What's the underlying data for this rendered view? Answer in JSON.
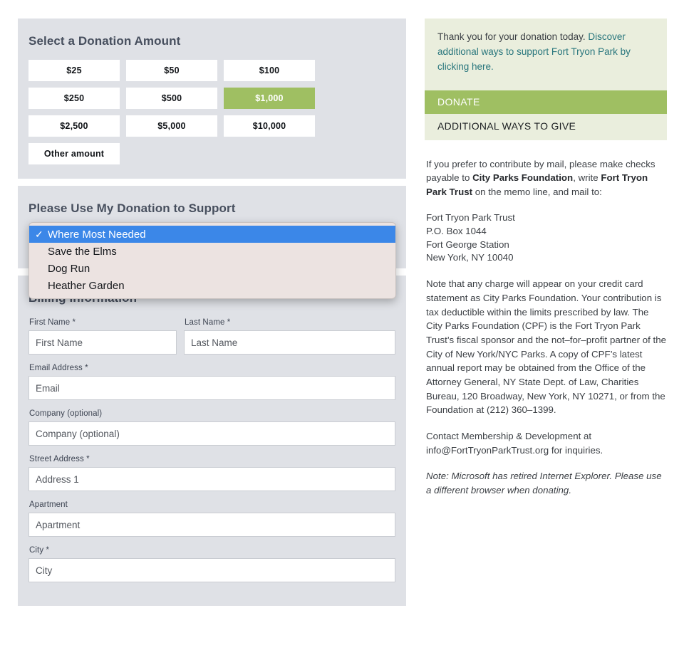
{
  "donation": {
    "title": "Select a Donation Amount",
    "amounts": [
      {
        "label": "$25",
        "selected": false
      },
      {
        "label": "$50",
        "selected": false
      },
      {
        "label": "$100",
        "selected": false
      },
      {
        "label": "$250",
        "selected": false
      },
      {
        "label": "$500",
        "selected": false
      },
      {
        "label": "$1,000",
        "selected": true
      },
      {
        "label": "$2,500",
        "selected": false
      },
      {
        "label": "$5,000",
        "selected": false
      },
      {
        "label": "$10,000",
        "selected": false
      },
      {
        "label": "Other amount",
        "selected": false
      }
    ],
    "selected_amount": "$1,000",
    "selected_color": "#9fbf62"
  },
  "designation": {
    "title": "Please Use My Donation to Support",
    "selected": "Where Most Needed",
    "dropdown_open": true,
    "options": [
      {
        "label": "Where Most Needed",
        "selected": true
      },
      {
        "label": "Save the Elms",
        "selected": false
      },
      {
        "label": "Dog Run",
        "selected": false
      },
      {
        "label": "Heather Garden",
        "selected": false
      }
    ],
    "highlight_color": "#3b87e8",
    "popup_background": "#ece3e1",
    "check_glyph": "✓"
  },
  "billing": {
    "title": "Billing Information",
    "fields": [
      {
        "label": "First Name *",
        "placeholder": "First Name",
        "value": ""
      },
      {
        "label": "Last Name *",
        "placeholder": "Last Name",
        "value": ""
      },
      {
        "label": "Email Address *",
        "placeholder": "Email",
        "value": ""
      },
      {
        "label": "Company (optional)",
        "placeholder": "Company (optional)",
        "value": ""
      },
      {
        "label": "Street Address *",
        "placeholder": "Address 1",
        "value": ""
      },
      {
        "label": "Apartment",
        "placeholder": "Apartment",
        "value": ""
      },
      {
        "label": "City *",
        "placeholder": "City",
        "value": ""
      }
    ]
  },
  "sidebar": {
    "thanks_prefix": "Thank you for your donation today. ",
    "thanks_link": "Discover additional ways to support Fort Tryon Park by clicking here.",
    "link_color": "#27757c",
    "donate_label": "DONATE",
    "ways_label": "ADDITIONAL WAYS TO GIVE",
    "mail_intro_1": "If you prefer to contribute by mail, please make checks payable to ",
    "mail_org": "City Parks Foundation",
    "mail_intro_2": ", write ",
    "mail_memo": "Fort Tryon Park Trust",
    "mail_intro_3": " on the memo line, and mail to:",
    "address": "Fort Tryon Park Trust\nP.O. Box 1044\nFort George Station\nNew York, NY 10040",
    "legal": "Note that any charge will appear on your credit card statement as City Parks Foundation. Your contribution is tax deductible within the limits prescribed by law. The City Parks Foundation (CPF) is the Fort Tryon Park Trust’s fiscal sponsor and the not–for–profit partner of the City of New York/NYC Parks. A copy of CPF’s latest annual report may be obtained from the Office of the Attorney General, NY State Dept. of Law, Charities Bureau, 120 Broadway, New York, NY 10271, or from the Foundation at (212) 360–1399.",
    "contact": "Contact Membership & Development at info@FortTryonParkTrust.org for inquiries.",
    "browser_note": "Note: Microsoft has retired Internet Explorer. Please use a different browser when donating.",
    "card_background": "#eaeedd"
  }
}
